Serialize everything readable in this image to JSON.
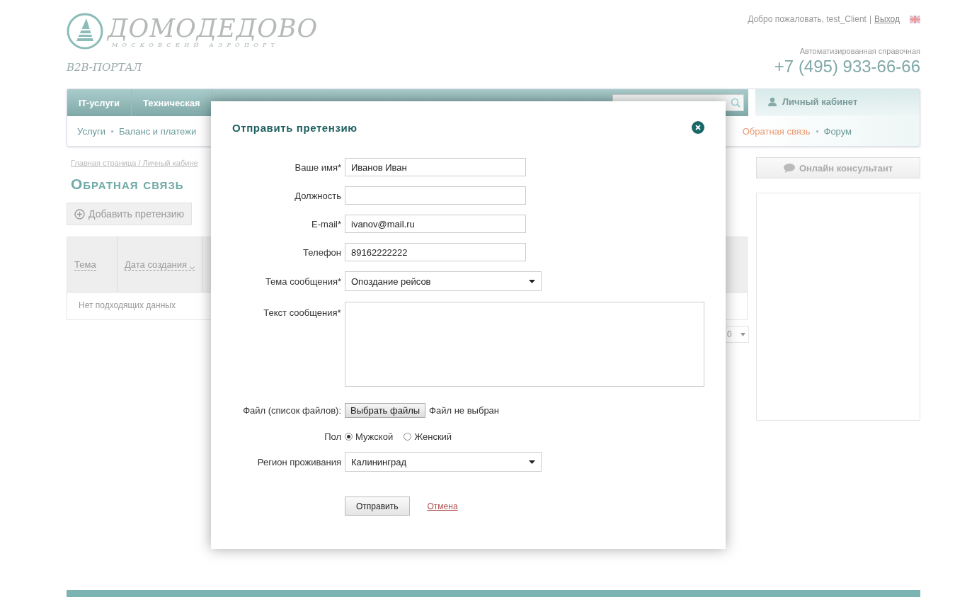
{
  "header": {
    "logo": {
      "name": "ДОМОДЕДОВО",
      "subtitle": "МОСКОВСКИЙ АЭРОПОРТ"
    },
    "portal": "B2B-ПОРТАЛ",
    "welcome": "Добро пожаловать, test_Client",
    "separator": "|",
    "logout": "Выход",
    "hotline_label": "Автоматизированная справочная",
    "phone": "+7 (495) 933-66-66"
  },
  "nav": {
    "top_items": [
      {
        "label": "IT-услуги"
      },
      {
        "label": "Техническая"
      }
    ],
    "sub_items_left": [
      {
        "label": "Услуги",
        "selected": false
      },
      {
        "label": "Баланс и платежи",
        "selected": false
      }
    ],
    "sub_items_right": [
      {
        "label": "Обратная связь",
        "selected": true
      },
      {
        "label": "Форум",
        "selected": false
      }
    ],
    "cabinet": "Личный кабинет"
  },
  "content": {
    "breadcrumb": "Главная страница / Личный кабине",
    "title": "Обратная связь",
    "add_button": "Добавить претензию",
    "table": {
      "columns": [
        {
          "label": "Тема",
          "sorted": false
        },
        {
          "label": "Дата создания",
          "sorted": true
        }
      ],
      "empty": "Нет подходящих данных"
    },
    "pager": "0"
  },
  "sidebar": {
    "consultant_button": "Онлайн консультант"
  },
  "modal": {
    "title": "Отправить претензию",
    "fields": [
      {
        "kind": "text",
        "label": "Ваше имя*",
        "value": "Иванов Иван"
      },
      {
        "kind": "text",
        "label": "Должность"
      },
      {
        "kind": "text",
        "label": "E-mail*",
        "value": "ivanov@mail.ru"
      },
      {
        "kind": "text",
        "label": "Телефон",
        "value": "89162222222"
      },
      {
        "kind": "select",
        "label": "Тема сообщения*",
        "value": "Опоздание рейсов"
      },
      {
        "kind": "textarea",
        "label": "Текст сообщения*"
      },
      {
        "kind": "file",
        "label": "Файл (список файлов):",
        "button": "Выбрать файлы",
        "status": "Файл не выбран"
      },
      {
        "kind": "radio",
        "label": "Пол",
        "options": [
          {
            "label": "Мужской",
            "selected": true
          },
          {
            "label": "Женский",
            "selected": false
          }
        ]
      },
      {
        "kind": "select",
        "label": "Регион проживания",
        "value": "Калининград"
      }
    ],
    "submit": "Отправить",
    "cancel": "Отмена"
  }
}
